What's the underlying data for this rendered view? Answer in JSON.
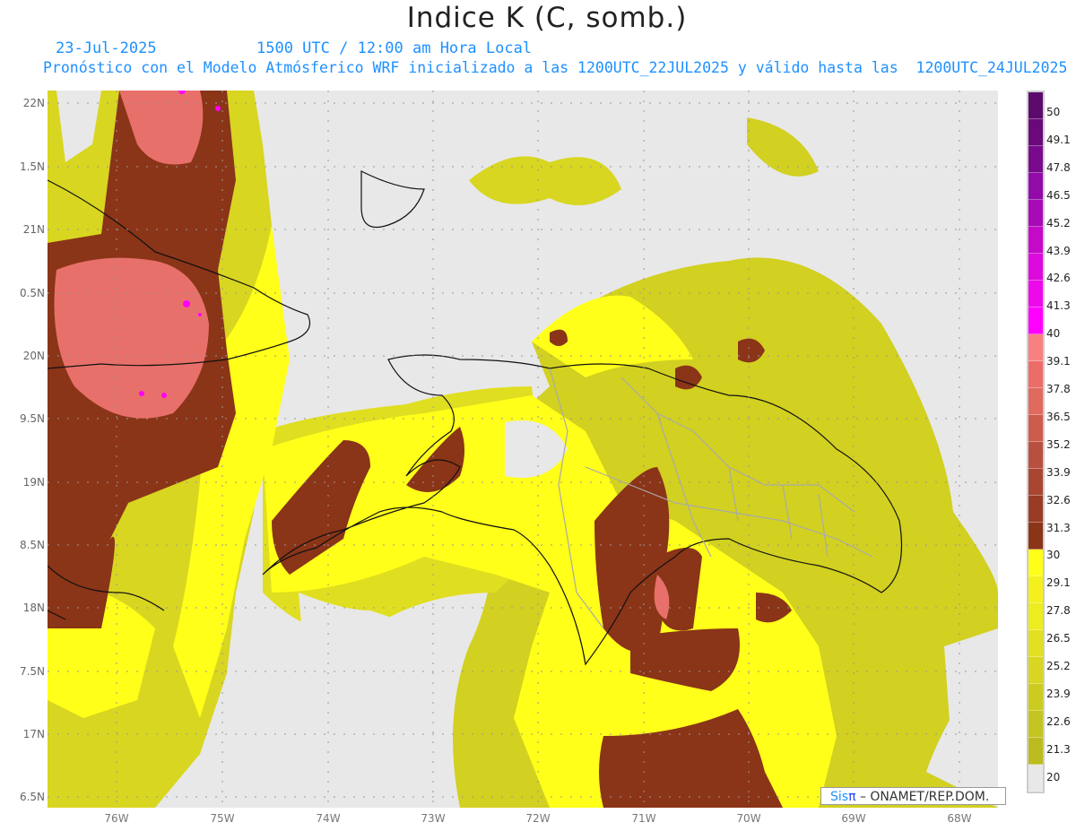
{
  "header": {
    "title": "Indice K (C, somb.)",
    "date": "23-Jul-2025",
    "time": "1500 UTC / 12:00 am Hora Local",
    "description": "Pronóstico con el Modelo Atmósferico WRF inicializado a las 1200UTC_22JUL2025 y válido hasta las  1200UTC_24JUL2025"
  },
  "axes": {
    "lat_labels": [
      "22N",
      "1.5N",
      "21N",
      "0.5N",
      "20N",
      "9.5N",
      "19N",
      "8.5N",
      "18N",
      "7.5N",
      "17N",
      "6.5N"
    ],
    "lon_labels": [
      "76W",
      "75W",
      "74W",
      "73W",
      "72W",
      "71W",
      "70W",
      "69W",
      "68W"
    ]
  },
  "colorbar": {
    "labels": [
      "50",
      "49.1",
      "47.8",
      "46.5",
      "45.2",
      "43.9",
      "42.6",
      "41.3",
      "40",
      "39.1",
      "37.8",
      "36.5",
      "35.2",
      "33.9",
      "32.6",
      "31.3",
      "30",
      "29.1",
      "27.8",
      "26.5",
      "25.2",
      "23.9",
      "22.6",
      "21.3",
      "20"
    ],
    "colors": [
      "#5c0a6c",
      "#6a0a7a",
      "#7a0a8c",
      "#920aa8",
      "#a80ab8",
      "#c40ac8",
      "#dc0adc",
      "#ec0aec",
      "#ff00ff",
      "#f88080",
      "#ec6c68",
      "#e06a5e",
      "#cc5c4c",
      "#b85040",
      "#a84632",
      "#983c26",
      "#8a3418",
      "#ffff1a",
      "#f4f01e",
      "#ecec1e",
      "#e2e020",
      "#d8d620",
      "#cccc20",
      "#c4c420",
      "#bcbc20",
      "#e8e8e8"
    ]
  },
  "credit": {
    "brand": "Sis",
    "pi": "π",
    "text": " –  ONAMET/REP.DOM."
  }
}
